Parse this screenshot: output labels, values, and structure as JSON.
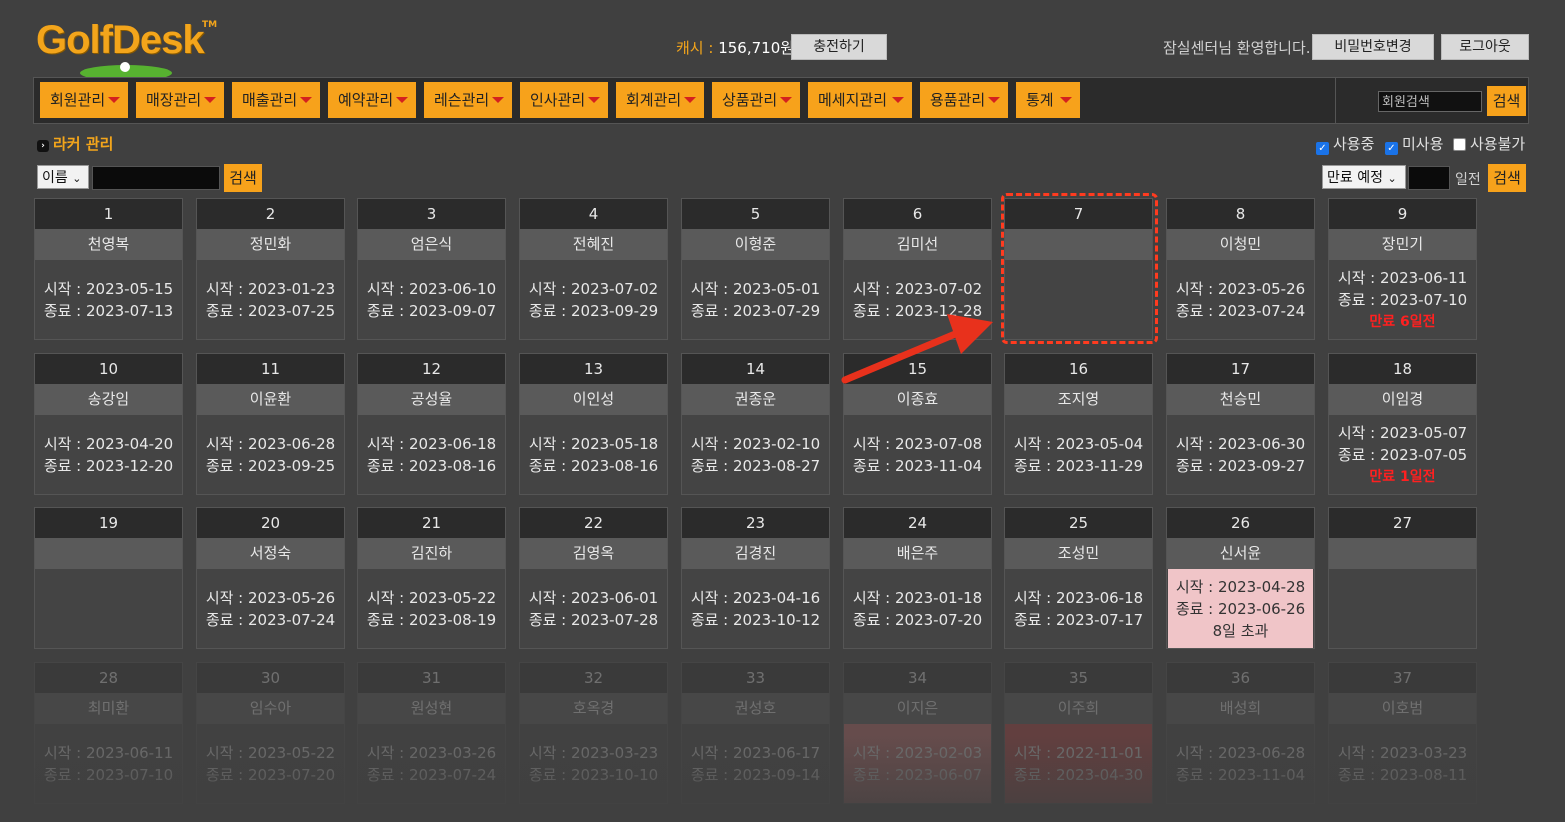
{
  "brand": {
    "name": "GolfDesk",
    "tm": "TM"
  },
  "header": {
    "cash_label": "캐시 :",
    "cash_value": "156,710원",
    "charge_button": "충전하기",
    "welcome": "잠실센터님 환영합니다.",
    "change_password": "비밀번호변경",
    "logout": "로그아웃"
  },
  "nav": {
    "items": [
      "회원관리",
      "매장관리",
      "매출관리",
      "예약관리",
      "레슨관리",
      "인사관리",
      "회계관리",
      "상품관리",
      "메세지관리",
      "용품관리",
      "통계"
    ],
    "search_placeholder": "회원검색",
    "search_button": "검색"
  },
  "section": {
    "title": "라커 관리"
  },
  "filters": {
    "in_use": "사용중",
    "unused": "미사용",
    "unavailable": "사용불가",
    "in_use_checked": true,
    "unused_checked": true,
    "unavailable_checked": false
  },
  "search": {
    "field": "이름",
    "button": "검색",
    "expire_select": "만료 예정",
    "days_label": "일전",
    "expire_button": "검색"
  },
  "colors": {
    "accent": "#f7a21b",
    "warn": "#ff2020",
    "highlight": "#ff3b1f"
  },
  "lockers": [
    {
      "num": "1",
      "name": "천영복",
      "start": "시작 : 2023-05-15",
      "end": "종료 : 2023-07-13",
      "note": "",
      "state": "normal"
    },
    {
      "num": "2",
      "name": "정민화",
      "start": "시작 : 2023-01-23",
      "end": "종료 : 2023-07-25",
      "note": "",
      "state": "normal"
    },
    {
      "num": "3",
      "name": "엄은식",
      "start": "시작 : 2023-06-10",
      "end": "종료 : 2023-09-07",
      "note": "",
      "state": "normal"
    },
    {
      "num": "4",
      "name": "전혜진",
      "start": "시작 : 2023-07-02",
      "end": "종료 : 2023-09-29",
      "note": "",
      "state": "normal"
    },
    {
      "num": "5",
      "name": "이형준",
      "start": "시작 : 2023-05-01",
      "end": "종료 : 2023-07-29",
      "note": "",
      "state": "normal"
    },
    {
      "num": "6",
      "name": "김미선",
      "start": "시작 : 2023-07-02",
      "end": "종료 : 2023-12-28",
      "note": "",
      "state": "normal"
    },
    {
      "num": "7",
      "name": "",
      "start": "",
      "end": "",
      "note": "",
      "state": "empty"
    },
    {
      "num": "8",
      "name": "이청민",
      "start": "시작 : 2023-05-26",
      "end": "종료 : 2023-07-24",
      "note": "",
      "state": "normal"
    },
    {
      "num": "9",
      "name": "장민기",
      "start": "시작 : 2023-06-11",
      "end": "종료 : 2023-07-10",
      "note": "만료 6일전",
      "state": "warn"
    },
    {
      "num": "10",
      "name": "송강임",
      "start": "시작 : 2023-04-20",
      "end": "종료 : 2023-12-20",
      "note": "",
      "state": "normal"
    },
    {
      "num": "11",
      "name": "이윤환",
      "start": "시작 : 2023-06-28",
      "end": "종료 : 2023-09-25",
      "note": "",
      "state": "normal"
    },
    {
      "num": "12",
      "name": "공성율",
      "start": "시작 : 2023-06-18",
      "end": "종료 : 2023-08-16",
      "note": "",
      "state": "normal"
    },
    {
      "num": "13",
      "name": "이인성",
      "start": "시작 : 2023-05-18",
      "end": "종료 : 2023-08-16",
      "note": "",
      "state": "normal"
    },
    {
      "num": "14",
      "name": "권종운",
      "start": "시작 : 2023-02-10",
      "end": "종료 : 2023-08-27",
      "note": "",
      "state": "normal"
    },
    {
      "num": "15",
      "name": "이종효",
      "start": "시작 : 2023-07-08",
      "end": "종료 : 2023-11-04",
      "note": "",
      "state": "normal"
    },
    {
      "num": "16",
      "name": "조지영",
      "start": "시작 : 2023-05-04",
      "end": "종료 : 2023-11-29",
      "note": "",
      "state": "normal"
    },
    {
      "num": "17",
      "name": "천승민",
      "start": "시작 : 2023-06-30",
      "end": "종료 : 2023-09-27",
      "note": "",
      "state": "normal"
    },
    {
      "num": "18",
      "name": "이임경",
      "start": "시작 : 2023-05-07",
      "end": "종료 : 2023-07-05",
      "note": "만료 1일전",
      "state": "warn"
    },
    {
      "num": "19",
      "name": "",
      "start": "",
      "end": "",
      "note": "",
      "state": "empty"
    },
    {
      "num": "20",
      "name": "서정숙",
      "start": "시작 : 2023-05-26",
      "end": "종료 : 2023-07-24",
      "note": "",
      "state": "normal"
    },
    {
      "num": "21",
      "name": "김진하",
      "start": "시작 : 2023-05-22",
      "end": "종료 : 2023-08-19",
      "note": "",
      "state": "normal"
    },
    {
      "num": "22",
      "name": "김영옥",
      "start": "시작 : 2023-06-01",
      "end": "종료 : 2023-07-28",
      "note": "",
      "state": "normal"
    },
    {
      "num": "23",
      "name": "김경진",
      "start": "시작 : 2023-04-16",
      "end": "종료 : 2023-10-12",
      "note": "",
      "state": "normal"
    },
    {
      "num": "24",
      "name": "배은주",
      "start": "시작 : 2023-01-18",
      "end": "종료 : 2023-07-20",
      "note": "",
      "state": "normal"
    },
    {
      "num": "25",
      "name": "조성민",
      "start": "시작 : 2023-06-18",
      "end": "종료 : 2023-07-17",
      "note": "",
      "state": "normal"
    },
    {
      "num": "26",
      "name": "신서윤",
      "start": "시작 : 2023-04-28",
      "end": "종료 : 2023-06-26",
      "note": "8일 초과",
      "state": "over"
    },
    {
      "num": "27",
      "name": "",
      "start": "",
      "end": "",
      "note": "",
      "state": "empty"
    },
    {
      "num": "28",
      "name": "최미환",
      "start": "시작 : 2023-06-11",
      "end": "종료 : 2023-07-10",
      "note": "",
      "state": "faded"
    },
    {
      "num": "30",
      "name": "임수아",
      "start": "시작 : 2023-05-22",
      "end": "종료 : 2023-07-20",
      "note": "",
      "state": "faded"
    },
    {
      "num": "31",
      "name": "원성현",
      "start": "시작 : 2023-03-26",
      "end": "종료 : 2023-07-24",
      "note": "",
      "state": "faded"
    },
    {
      "num": "32",
      "name": "호옥경",
      "start": "시작 : 2023-03-23",
      "end": "종료 : 2023-10-10",
      "note": "",
      "state": "faded"
    },
    {
      "num": "33",
      "name": "권성호",
      "start": "시작 : 2023-06-17",
      "end": "종료 : 2023-09-14",
      "note": "",
      "state": "faded"
    },
    {
      "num": "34",
      "name": "이지은",
      "start": "시작 : 2023-02-03",
      "end": "종료 : 2023-06-07",
      "note": "",
      "state": "faded-over"
    },
    {
      "num": "35",
      "name": "이주희",
      "start": "시작 : 2022-11-01",
      "end": "종료 : 2023-04-30",
      "note": "",
      "state": "faded-red"
    },
    {
      "num": "36",
      "name": "배성희",
      "start": "시작 : 2023-06-28",
      "end": "종료 : 2023-11-04",
      "note": "",
      "state": "faded"
    },
    {
      "num": "37",
      "name": "이호범",
      "start": "시작 : 2023-03-23",
      "end": "종료 : 2023-08-11",
      "note": "",
      "state": "faded"
    }
  ]
}
